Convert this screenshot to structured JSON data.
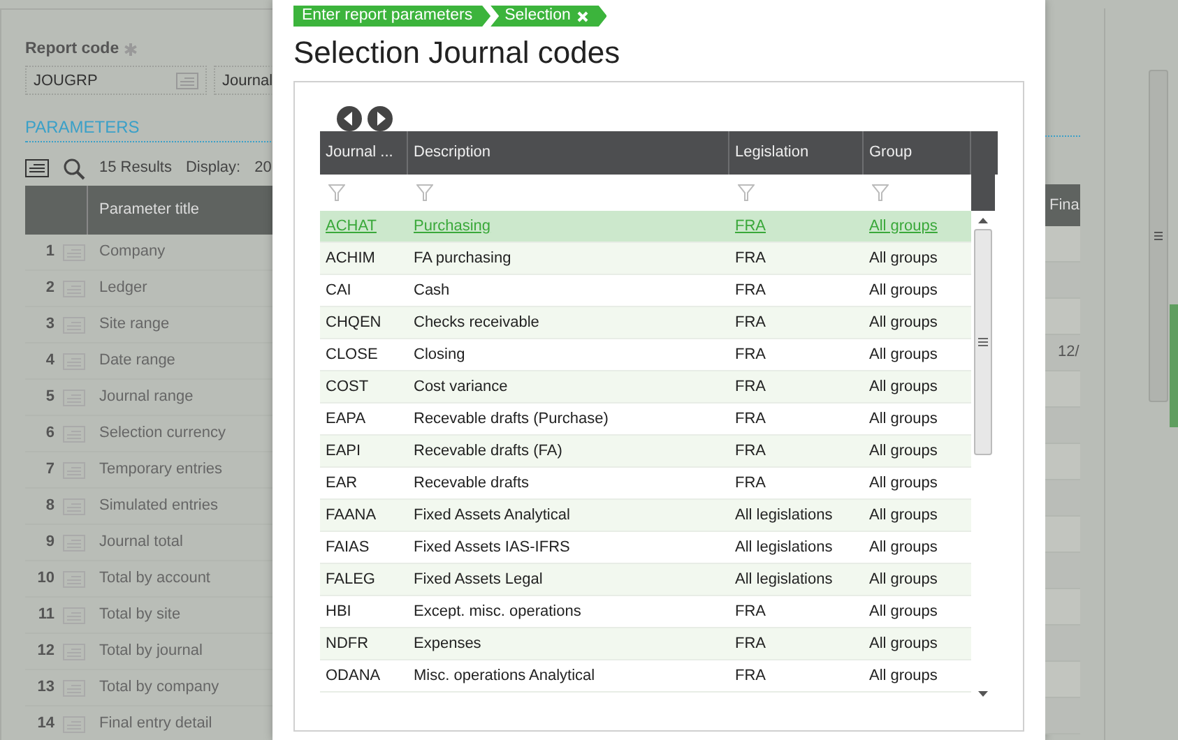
{
  "background": {
    "report_code": {
      "label": "Report code",
      "required": true,
      "value": "JOUGRP"
    },
    "journal_field": "Journal",
    "section_title": "PARAMETERS",
    "results": "15 Results",
    "display_label": "Display:",
    "display_value": "20",
    "columns": [
      "Parameter title",
      "Fina"
    ],
    "rows": [
      {
        "number": "1",
        "title": "Company"
      },
      {
        "number": "2",
        "title": "Ledger"
      },
      {
        "number": "3",
        "title": "Site range"
      },
      {
        "number": "4",
        "title": "Date range",
        "value": "12/"
      },
      {
        "number": "5",
        "title": "Journal range"
      },
      {
        "number": "6",
        "title": "Selection currency"
      },
      {
        "number": "7",
        "title": "Temporary entries"
      },
      {
        "number": "8",
        "title": "Simulated entries"
      },
      {
        "number": "9",
        "title": "Journal total"
      },
      {
        "number": "10",
        "title": "Total by account"
      },
      {
        "number": "11",
        "title": "Total by site"
      },
      {
        "number": "12",
        "title": "Total by journal"
      },
      {
        "number": "13",
        "title": "Total by company"
      },
      {
        "number": "14",
        "title": "Final entry detail"
      }
    ]
  },
  "dialog": {
    "breadcrumbs": [
      {
        "label": "Enter report parameters",
        "closable": false
      },
      {
        "label": "Selection",
        "closable": true
      }
    ],
    "title": "Selection Journal codes",
    "grid": {
      "columns": [
        "Journal ...",
        "Description",
        "Legislation",
        "Group"
      ],
      "rows": [
        {
          "cells": [
            "ACHAT",
            "Purchasing",
            "FRA",
            "All groups"
          ],
          "selected": true
        },
        {
          "cells": [
            "ACHIM",
            "FA purchasing",
            "FRA",
            "All groups"
          ],
          "selected": false
        },
        {
          "cells": [
            "CAI",
            "Cash",
            "FRA",
            "All groups"
          ],
          "selected": false
        },
        {
          "cells": [
            "CHQEN",
            "Checks receivable",
            "FRA",
            "All groups"
          ],
          "selected": false
        },
        {
          "cells": [
            "CLOSE",
            "Closing",
            "FRA",
            "All groups"
          ],
          "selected": false
        },
        {
          "cells": [
            "COST",
            "Cost variance",
            "FRA",
            "All groups"
          ],
          "selected": false
        },
        {
          "cells": [
            "EAPA",
            "Recevable drafts (Purchase)",
            "FRA",
            "All groups"
          ],
          "selected": false
        },
        {
          "cells": [
            "EAPI",
            "Recevable drafts (FA)",
            "FRA",
            "All groups"
          ],
          "selected": false
        },
        {
          "cells": [
            "EAR",
            "Recevable drafts",
            "FRA",
            "All groups"
          ],
          "selected": false
        },
        {
          "cells": [
            "FAANA",
            "Fixed Assets Analytical",
            "All legislations",
            "All groups"
          ],
          "selected": false
        },
        {
          "cells": [
            "FAIAS",
            "Fixed Assets IAS-IFRS",
            "All legislations",
            "All groups"
          ],
          "selected": false
        },
        {
          "cells": [
            "FALEG",
            "Fixed Assets Legal",
            "All legislations",
            "All groups"
          ],
          "selected": false
        },
        {
          "cells": [
            "HBI",
            "Except. misc. operations",
            "FRA",
            "All groups"
          ],
          "selected": false
        },
        {
          "cells": [
            "NDFR",
            "Expenses",
            "FRA",
            "All groups"
          ],
          "selected": false
        },
        {
          "cells": [
            "ODANA",
            "Misc. operations Analytical",
            "FRA",
            "All groups"
          ],
          "selected": false
        }
      ]
    }
  }
}
